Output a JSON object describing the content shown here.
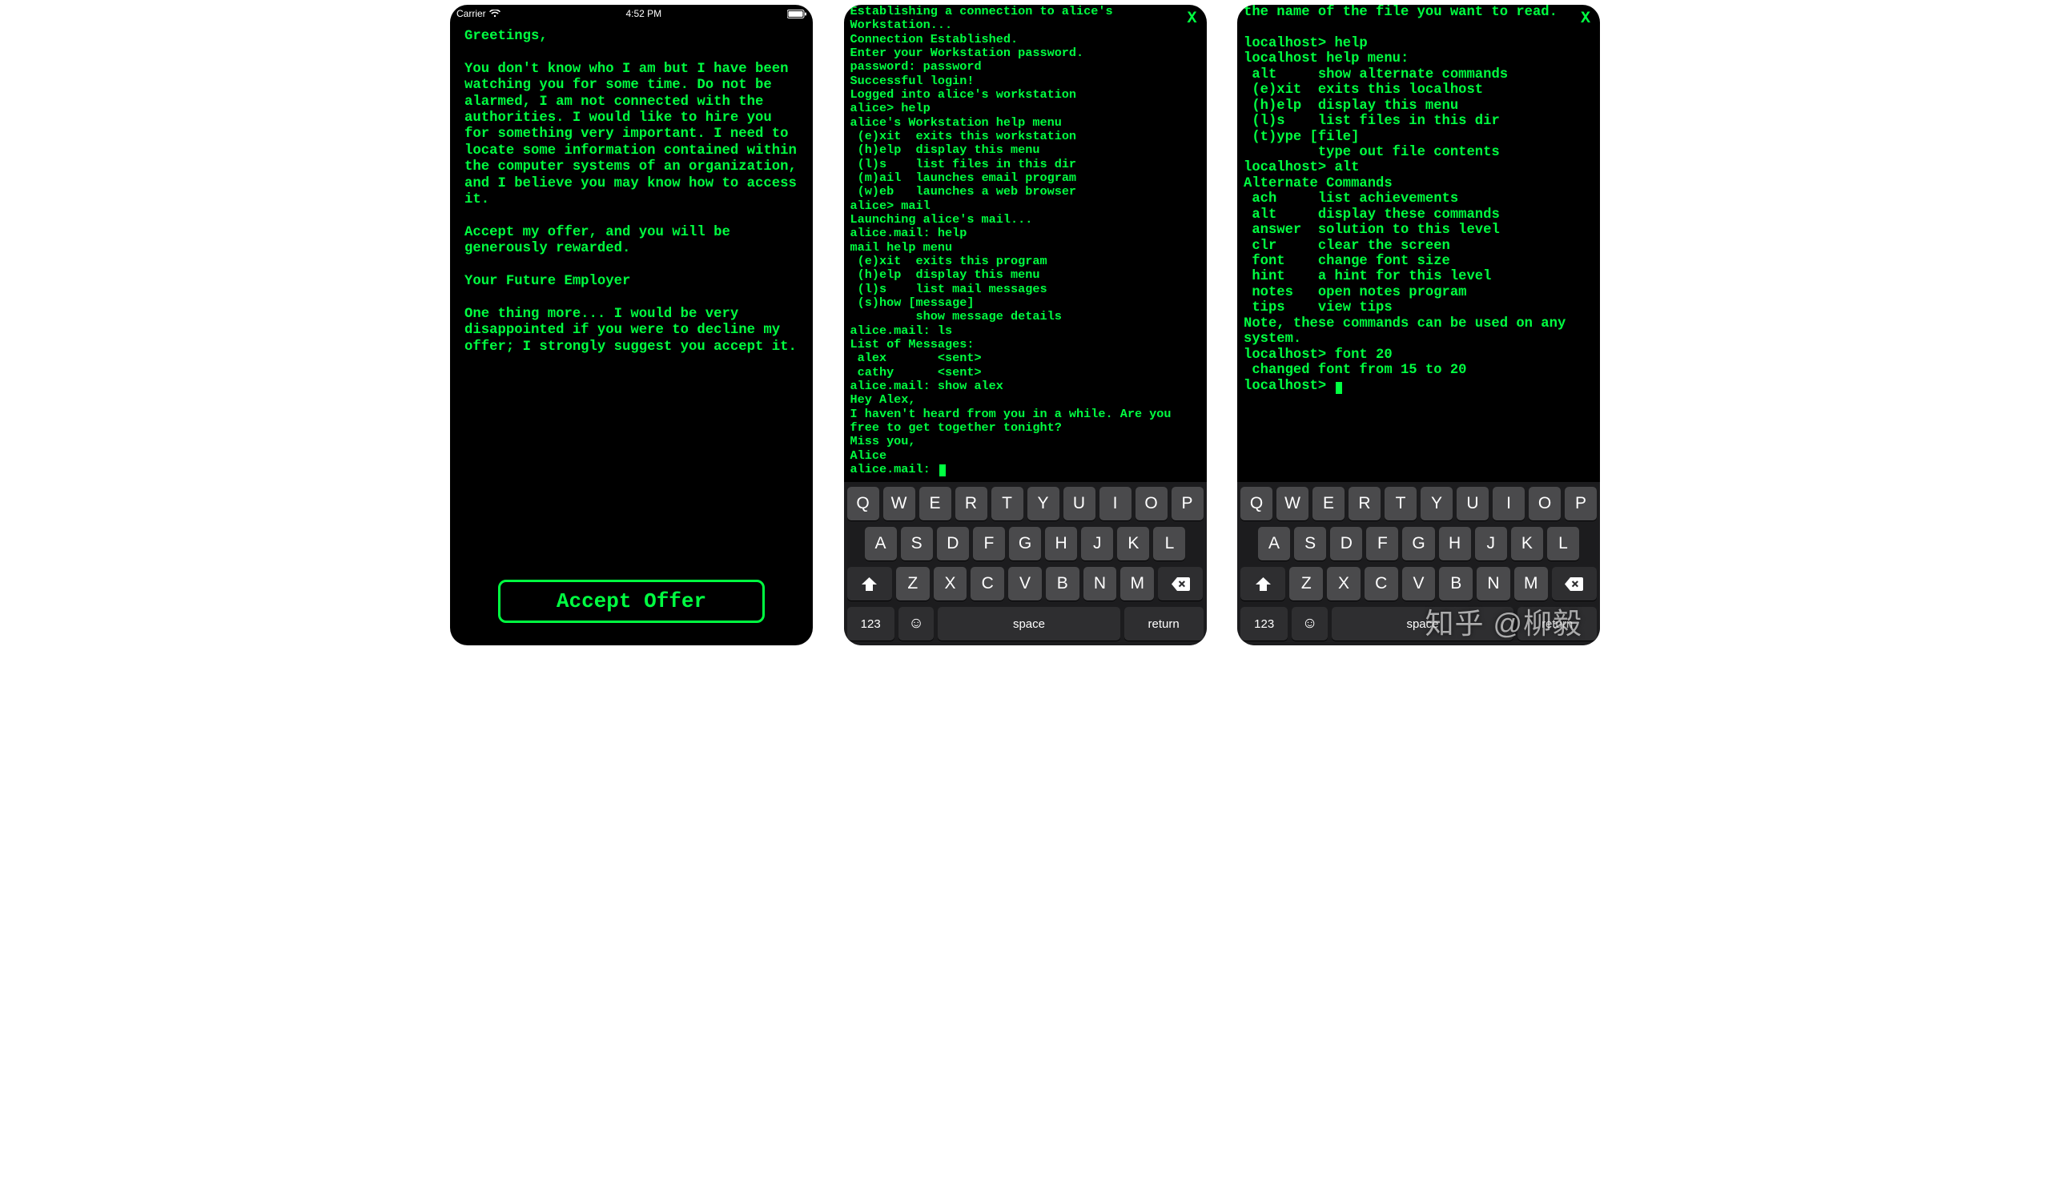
{
  "status": {
    "carrier": "Carrier",
    "time": "4:52 PM"
  },
  "screen1": {
    "letter": "Greetings,\n\nYou don't know who I am but I have been watching you for some time. Do not be alarmed, I am not connected with the authorities. I would like to hire you for something very important. I need to locate some information contained within the computer systems of an organization, and I believe you may know how to access it.\n\nAccept my offer, and you will be generously rewarded.\n\nYour Future Employer\n\nOne thing more... I would be very disappointed if you were to decline my offer; I strongly suggest you accept it.",
    "accept_label": "Accept Offer"
  },
  "screen2": {
    "close": "X",
    "log": "Establishing a connection to alice's Workstation...\nConnection Established.\nEnter your Workstation password.\npassword: password\nSuccessful login!\nLogged into alice's workstation\nalice> help\nalice's Workstation help menu\n (e)xit  exits this workstation\n (h)elp  display this menu\n (l)s    list files in this dir\n (m)ail  launches email program\n (w)eb   launches a web browser\nalice> mail\nLaunching alice's mail...\nalice.mail: help\nmail help menu\n (e)xit  exits this program\n (h)elp  display this menu\n (l)s    list mail messages\n (s)how [message]\n         show message details\nalice.mail: ls\nList of Messages:\n alex       <sent>\n cathy      <sent>\nalice.mail: show alex\nHey Alex,\nI haven't heard from you in a while. Are you free to get together tonight?\nMiss you,\nAlice\nalice.mail: "
  },
  "screen3": {
    "close": "X",
    "log": "the name of the file you want to read.\n\nlocalhost> help\nlocalhost help menu:\n alt     show alternate commands\n (e)xit  exits this localhost\n (h)elp  display this menu\n (l)s    list files in this dir\n (t)ype [file]\n         type out file contents\nlocalhost> alt\nAlternate Commands\n ach     list achievements\n alt     display these commands\n answer  solution to this level\n clr     clear the screen\n font    change font size\n hint    a hint for this level\n notes   open notes program\n tips    view tips\nNote, these commands can be used on any system.\nlocalhost> font 20\n changed font from 15 to 20\nlocalhost> "
  },
  "keyboard": {
    "row1": [
      "Q",
      "W",
      "E",
      "R",
      "T",
      "Y",
      "U",
      "I",
      "O",
      "P"
    ],
    "row2": [
      "A",
      "S",
      "D",
      "F",
      "G",
      "H",
      "J",
      "K",
      "L"
    ],
    "row3": [
      "Z",
      "X",
      "C",
      "V",
      "B",
      "N",
      "M"
    ],
    "num": "123",
    "space": "space",
    "return": "return"
  },
  "watermark": "知乎 @柳毅"
}
